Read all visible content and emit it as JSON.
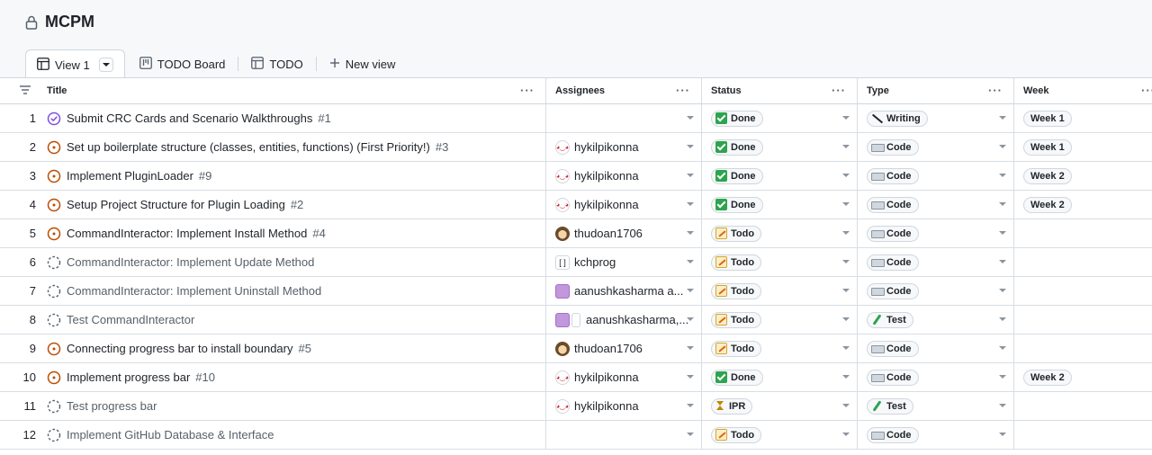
{
  "project": {
    "title": "MCPM"
  },
  "tabs": [
    {
      "label": "View 1",
      "active": true,
      "icon": "table-icon"
    },
    {
      "label": "TODO Board",
      "active": false,
      "icon": "board-icon"
    },
    {
      "label": "TODO",
      "active": false,
      "icon": "table-icon"
    }
  ],
  "new_view_label": "New view",
  "columns": {
    "title": "Title",
    "assignees": "Assignees",
    "status": "Status",
    "type": "Type",
    "week": "Week",
    "menu": "···"
  },
  "colors": {
    "open": "#bc4c00",
    "closed": "#8250df",
    "draft": "#57606a"
  },
  "rows": [
    {
      "num": "1",
      "state": "closed",
      "title": "Submit CRC Cards and Scenario Walkthroughs",
      "issue": "#1",
      "assignee": "",
      "avatar": "",
      "status": "Done",
      "status_icon": "done",
      "type": "Writing",
      "type_icon": "writing",
      "week": "Week 1"
    },
    {
      "num": "2",
      "state": "open",
      "title": "Set up boilerplate structure (classes, entities, functions) (First Priority!)",
      "issue": "#3",
      "assignee": "hykilpikonna",
      "avatar": "hyk",
      "status": "Done",
      "status_icon": "done",
      "type": "Code",
      "type_icon": "code",
      "week": "Week 1"
    },
    {
      "num": "3",
      "state": "open",
      "title": "Implement PluginLoader",
      "issue": "#9",
      "assignee": "hykilpikonna",
      "avatar": "hyk",
      "status": "Done",
      "status_icon": "done",
      "type": "Code",
      "type_icon": "code",
      "week": "Week 2"
    },
    {
      "num": "4",
      "state": "open",
      "title": "Setup Project Structure for Plugin Loading",
      "issue": "#2",
      "assignee": "hykilpikonna",
      "avatar": "hyk",
      "status": "Done",
      "status_icon": "done",
      "type": "Code",
      "type_icon": "code",
      "week": "Week 2"
    },
    {
      "num": "5",
      "state": "open",
      "title": "CommandInteractor: Implement Install Method",
      "issue": "#4",
      "assignee": "thudoan1706",
      "avatar": "thu",
      "status": "Todo",
      "status_icon": "todo",
      "type": "Code",
      "type_icon": "code",
      "week": ""
    },
    {
      "num": "6",
      "state": "draft",
      "title": "CommandInteractor: Implement Update Method",
      "issue": "",
      "assignee": "kchprog",
      "avatar": "kch",
      "status": "Todo",
      "status_icon": "todo",
      "type": "Code",
      "type_icon": "code",
      "week": ""
    },
    {
      "num": "7",
      "state": "draft",
      "title": "CommandInteractor: Implement Uninstall Method",
      "issue": "",
      "assignee": "aanushkasharma a...",
      "avatar": "aan",
      "status": "Todo",
      "status_icon": "todo",
      "type": "Code",
      "type_icon": "code",
      "week": ""
    },
    {
      "num": "8",
      "state": "draft",
      "title": "Test CommandInteractor",
      "issue": "",
      "assignee": "aanushkasharma,...",
      "avatar": "aan2",
      "status": "Todo",
      "status_icon": "todo",
      "type": "Test",
      "type_icon": "test",
      "week": ""
    },
    {
      "num": "9",
      "state": "open",
      "title": "Connecting progress bar to install boundary",
      "issue": "#5",
      "assignee": "thudoan1706",
      "avatar": "thu",
      "status": "Todo",
      "status_icon": "todo",
      "type": "Code",
      "type_icon": "code",
      "week": ""
    },
    {
      "num": "10",
      "state": "open",
      "title": "Implement progress bar",
      "issue": "#10",
      "assignee": "hykilpikonna",
      "avatar": "hyk",
      "status": "Done",
      "status_icon": "done",
      "type": "Code",
      "type_icon": "code",
      "week": "Week 2"
    },
    {
      "num": "11",
      "state": "draft",
      "title": "Test progress bar",
      "issue": "",
      "assignee": "hykilpikonna",
      "avatar": "hyk",
      "status": "IPR",
      "status_icon": "ipr",
      "type": "Test",
      "type_icon": "test",
      "week": ""
    },
    {
      "num": "12",
      "state": "draft",
      "title": "Implement GitHub Database & Interface",
      "issue": "",
      "assignee": "",
      "avatar": "",
      "status": "Todo",
      "status_icon": "todo",
      "type": "Code",
      "type_icon": "code",
      "week": ""
    }
  ]
}
